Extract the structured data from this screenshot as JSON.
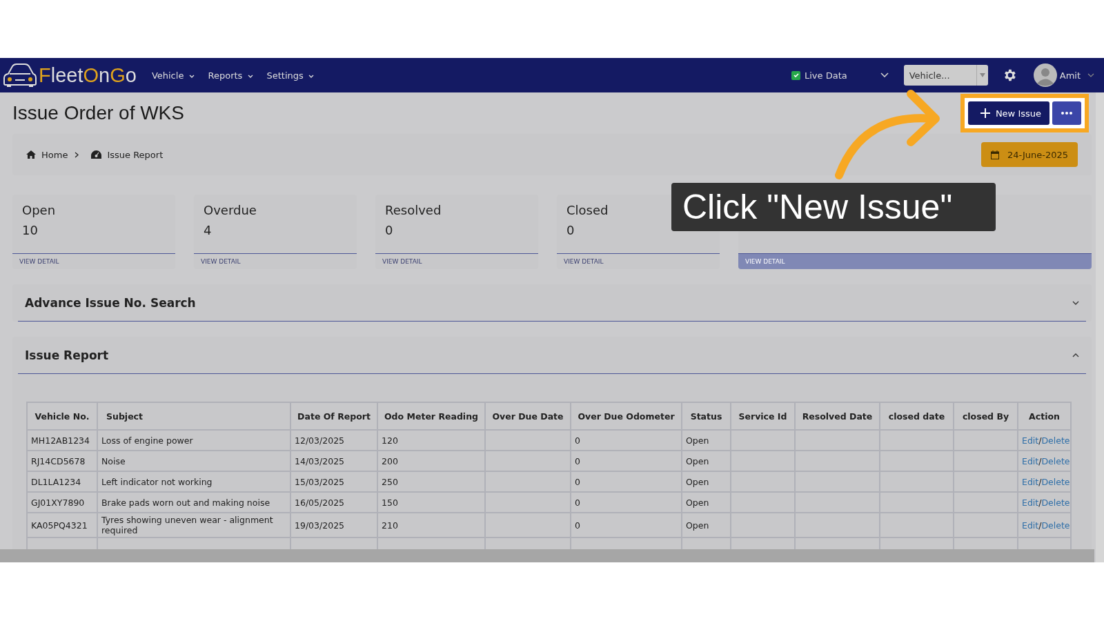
{
  "navbar": {
    "brand": [
      {
        "text": "F",
        "accent": true
      },
      {
        "text": "leet",
        "accent": false
      },
      {
        "text": "O",
        "accent": true
      },
      {
        "text": "n",
        "accent": false
      },
      {
        "text": "G",
        "accent": true
      },
      {
        "text": "o",
        "accent": false
      }
    ],
    "menu": [
      "Vehicle",
      "Reports",
      "Settings"
    ],
    "live_data": {
      "label": "Live Data",
      "checked": true
    },
    "vehicle_select": {
      "placeholder": "Vehicle..."
    },
    "user": "Amit"
  },
  "page_title": "Issue Order of WKS",
  "actions": {
    "new_issue": "New Issue"
  },
  "breadcrumb": [
    "Home",
    "Issue Report"
  ],
  "date": "24-June-2025",
  "cards": [
    {
      "title": "Open",
      "count": "10",
      "link": "VIEW DETAIL"
    },
    {
      "title": "Overdue",
      "count": "4",
      "link": "VIEW DETAIL"
    },
    {
      "title": "Resolved",
      "count": "0",
      "link": "VIEW DETAIL"
    },
    {
      "title": "Closed",
      "count": "0",
      "link": "VIEW DETAIL"
    },
    {
      "link": "VIEW DETAIL"
    }
  ],
  "sections": [
    {
      "title": "Advance Issue No. Search",
      "expanded": false
    },
    {
      "title": "Issue Report",
      "expanded": true
    }
  ],
  "table": {
    "columns": [
      "Vehicle No.",
      "Subject",
      "Date Of Report",
      "Odo Meter Reading",
      "Over Due Date",
      "Over Due Odometer",
      "Status",
      "Service Id",
      "Resolved Date",
      "closed date",
      "closed By",
      "Action"
    ],
    "rows": [
      {
        "cells": [
          "MH12AB1234",
          "Loss of engine power",
          "12/03/2025",
          "120",
          "",
          "0",
          "Open",
          "",
          "",
          "",
          ""
        ],
        "edit": "Edit",
        "sep": "/",
        "delete": "Delete"
      },
      {
        "cells": [
          "RJ14CD5678",
          "Noise",
          "14/03/2025",
          "200",
          "",
          "0",
          "Open",
          "",
          "",
          "",
          ""
        ],
        "edit": "Edit",
        "sep": "/",
        "delete": "Delete"
      },
      {
        "cells": [
          "DL1LA1234",
          "Left indicator not working",
          "15/03/2025",
          "250",
          "",
          "0",
          "Open",
          "",
          "",
          "",
          ""
        ],
        "edit": "Edit",
        "sep": "/",
        "delete": "Delete"
      },
      {
        "cells": [
          "GJ01XY7890",
          "Brake pads worn out and making noise",
          "16/05/2025",
          "150",
          "",
          "0",
          "Open",
          "",
          "",
          "",
          ""
        ],
        "edit": "Edit",
        "sep": "/",
        "delete": "Delete"
      },
      {
        "cells": [
          "KA05PQ4321",
          "Tyres showing uneven wear - alignment required",
          "19/03/2025",
          "210",
          "",
          "0",
          "Open",
          "",
          "",
          "",
          ""
        ],
        "edit": "Edit",
        "sep": "/",
        "delete": "Delete"
      }
    ]
  },
  "tooltip": "Click \"New Issue\""
}
